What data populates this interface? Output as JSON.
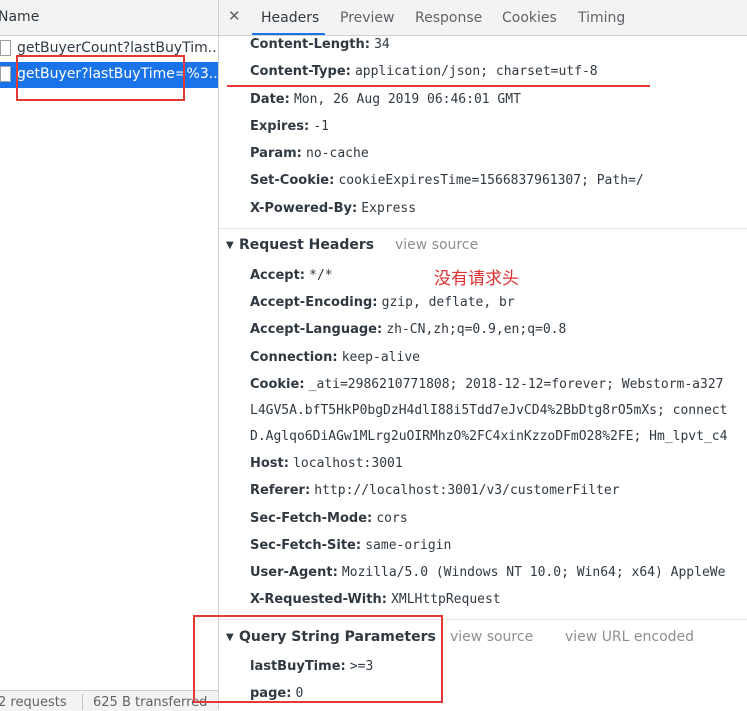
{
  "request_list": {
    "header": "Name",
    "items": [
      {
        "label": "getBuyerCount?lastBuyTim..."
      },
      {
        "label": "getBuyer?lastBuyTime=%3..."
      }
    ],
    "footer": {
      "requests": "2 requests",
      "transferred": "625 B transferred"
    }
  },
  "tabs": {
    "items": [
      "Headers",
      "Preview",
      "Response",
      "Cookies",
      "Timing"
    ],
    "active": "Headers"
  },
  "response_headers": [
    {
      "key": "Content-Length:",
      "value": "34"
    },
    {
      "key": "Content-Type:",
      "value": "application/json; charset=utf-8"
    },
    {
      "key": "Date:",
      "value": "Mon, 26 Aug 2019 06:46:01 GMT"
    },
    {
      "key": "Expires:",
      "value": "-1"
    },
    {
      "key": "Param:",
      "value": "no-cache"
    },
    {
      "key": "Set-Cookie:",
      "value": "cookieExpiresTime=1566837961307; Path=/"
    },
    {
      "key": "X-Powered-By:",
      "value": "Express"
    }
  ],
  "request_headers_section": {
    "title": "Request Headers",
    "view_source": "view source"
  },
  "annotation": "没有请求头",
  "request_headers": [
    {
      "key": "Accept:",
      "value": "*/*"
    },
    {
      "key": "Accept-Encoding:",
      "value": "gzip, deflate, br"
    },
    {
      "key": "Accept-Language:",
      "value": "zh-CN,zh;q=0.9,en;q=0.8"
    },
    {
      "key": "Connection:",
      "value": "keep-alive"
    },
    {
      "key": "Cookie:",
      "value": "_ati=2986210771808; 2018-12-12=forever; Webstorm-a327"
    },
    {
      "key": "",
      "value": "L4GV5A.bfT5HkP0bgDzH4dlI88i5Tdd7eJvCD4%2BbDtg8rO5mXs; connect"
    },
    {
      "key": "",
      "value": "D.Aglqo6DiAGw1MLrg2uOIRMhzO%2FC4xinKzzoDFmO28%2FE; Hm_lpvt_c4"
    },
    {
      "key": "Host:",
      "value": "localhost:3001"
    },
    {
      "key": "Referer:",
      "value": "http://localhost:3001/v3/customerFilter"
    },
    {
      "key": "Sec-Fetch-Mode:",
      "value": "cors"
    },
    {
      "key": "Sec-Fetch-Site:",
      "value": "same-origin"
    },
    {
      "key": "User-Agent:",
      "value": "Mozilla/5.0 (Windows NT 10.0; Win64; x64) AppleWe"
    },
    {
      "key": "X-Requested-With:",
      "value": "XMLHttpRequest"
    }
  ],
  "query_section": {
    "title": "Query String Parameters",
    "view_source": "view source",
    "view_url_encoded": "view URL encoded"
  },
  "query_params": [
    {
      "key": "lastBuyTime:",
      "value": ">=3"
    },
    {
      "key": "page:",
      "value": "0"
    }
  ],
  "colors": {
    "accent": "#1a73e8",
    "highlight_red": "#e53935",
    "annotation_red": "#e03030"
  }
}
